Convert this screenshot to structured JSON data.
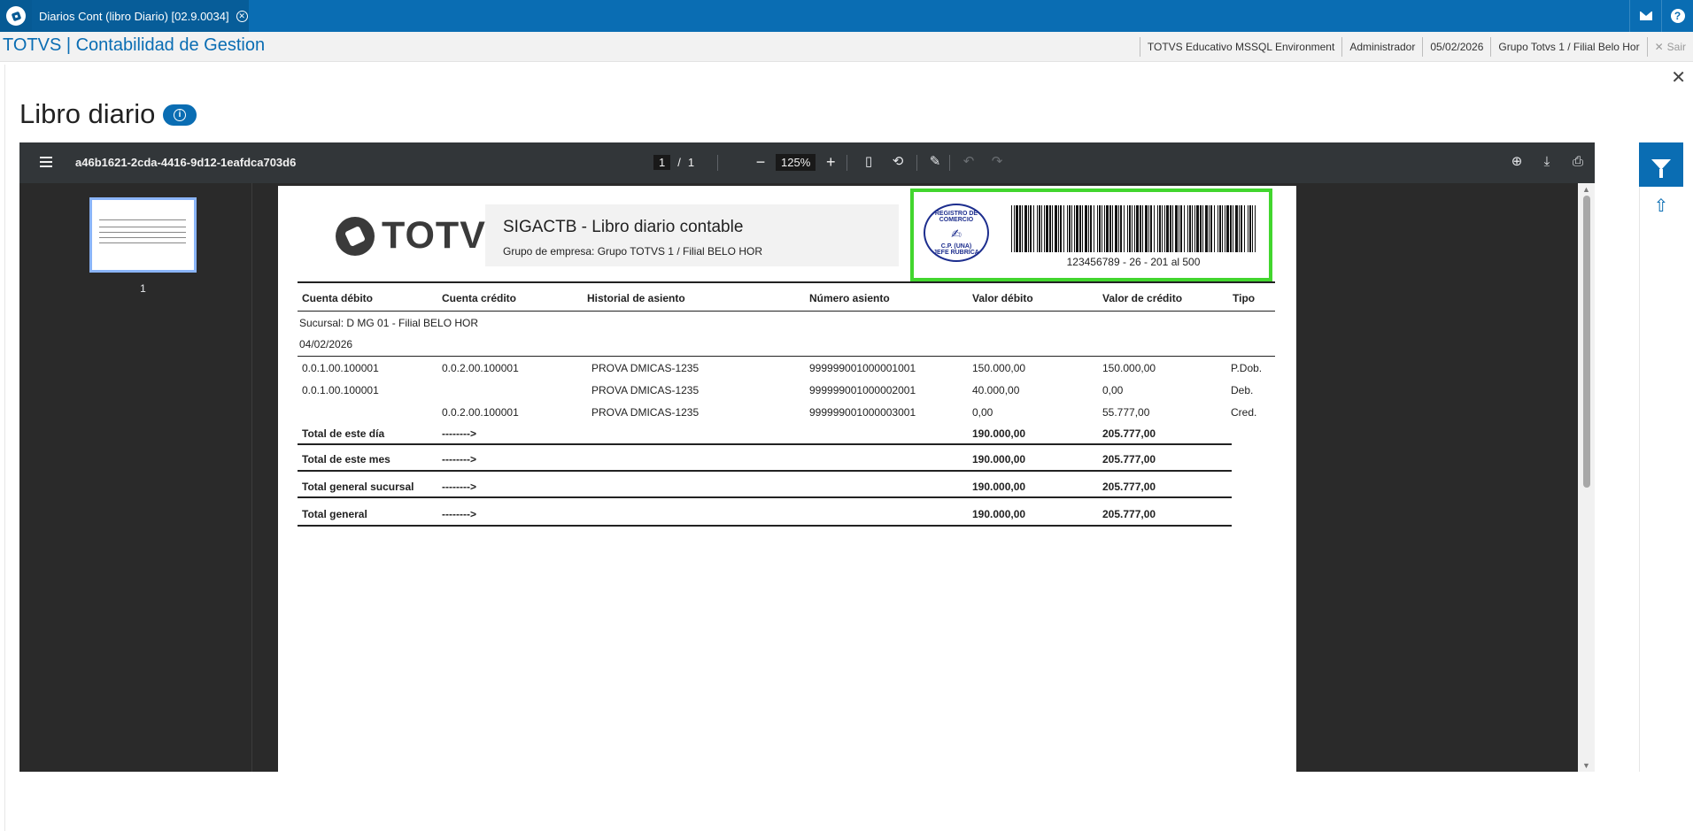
{
  "tab": {
    "label": "Diarios Cont (libro Diario) [02.9.0034]"
  },
  "app": {
    "title": "TOTVS | Contabilidad de Gestion"
  },
  "status": {
    "environment": "TOTVS Educativo MSSQL Environment",
    "user": "Administrador",
    "date": "05/02/2026",
    "group": "Grupo Totvs 1 / Filial Belo Hor",
    "exit": "Sair"
  },
  "page": {
    "title": "Libro diario"
  },
  "viewer": {
    "doc_name": "a46b1621-2cda-4416-9d12-1eafdca703d6",
    "page_current": "1",
    "page_sep": "/",
    "page_total": "1",
    "zoom": "125%",
    "thumb_label": "1"
  },
  "report": {
    "logo": "TOTVS",
    "title": "SIGACTB - Libro diario contable",
    "group": "Grupo de empresa:  Grupo TOTVS 1 / Filial BELO HOR",
    "seal_top": "REGISTRO DE COMERCIO",
    "seal_mid": "C.P. (UNA)",
    "seal_bottom": "JEFE RUBRICA",
    "barcode_text": "123456789 - 26 - 201 al 500",
    "columns": [
      "Cuenta débito",
      "Cuenta crédito",
      "Historial de asiento",
      "Número asiento",
      "Valor débito",
      "Valor de crédito",
      "Tipo"
    ],
    "branch": "Sucursal:   D MG 01  - Filial BELO HOR",
    "date": "04/02/2026",
    "rows": [
      {
        "debit_acct": "0.0.1.00.100001",
        "credit_acct": "0.0.2.00.100001",
        "history": "PROVA DMICAS-1235",
        "entry": "999999001000001001",
        "debit": "150.000,00",
        "credit": "150.000,00",
        "type": "P.Dob."
      },
      {
        "debit_acct": "0.0.1.00.100001",
        "credit_acct": "",
        "history": "PROVA DMICAS-1235",
        "entry": "999999001000002001",
        "debit": "40.000,00",
        "credit": "0,00",
        "type": "Deb."
      },
      {
        "debit_acct": "",
        "credit_acct": "0.0.2.00.100001",
        "history": "PROVA DMICAS-1235",
        "entry": "999999001000003001",
        "debit": "0,00",
        "credit": "55.777,00",
        "type": "Cred."
      }
    ],
    "totals": [
      {
        "label": "Total de este día",
        "arrow": "-------->",
        "debit": "190.000,00",
        "credit": "205.777,00"
      },
      {
        "label": "Total de este mes",
        "arrow": "-------->",
        "debit": "190.000,00",
        "credit": "205.777,00"
      },
      {
        "label": "Total general sucursal",
        "arrow": "-------->",
        "debit": "190.000,00",
        "credit": "205.777,00"
      },
      {
        "label": "Total general",
        "arrow": "-------->",
        "debit": "190.000,00",
        "credit": "205.777,00"
      }
    ]
  },
  "colors": {
    "accent": "#0a6db3",
    "stamp_border": "#42d62e",
    "viewer_toolbar": "#323639",
    "seal": "#1d2e8e"
  },
  "icons": [
    "totvs-logo-icon",
    "close-icon",
    "mail-icon",
    "help-icon",
    "info-icon",
    "menu-icon",
    "fit-page-icon",
    "rotate-icon",
    "annotate-icon",
    "undo-icon",
    "redo-icon",
    "add-to-drive-icon",
    "download-icon",
    "print-icon",
    "more-icon",
    "filter-icon",
    "upload-icon"
  ]
}
